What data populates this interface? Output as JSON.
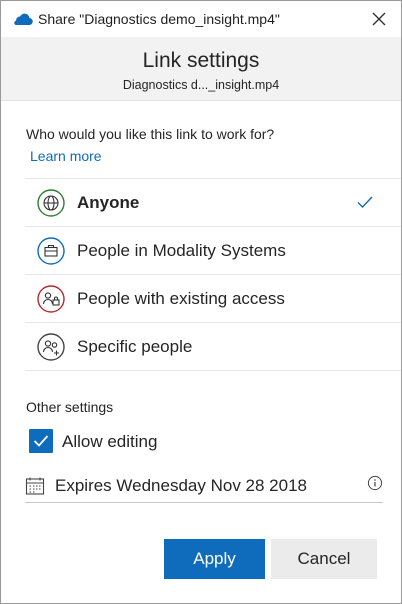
{
  "window": {
    "title": "Share \"Diagnostics demo_insight.mp4\"",
    "app_icon": "onedrive-cloud-icon",
    "close_icon": "close-icon"
  },
  "header": {
    "title": "Link settings",
    "filename": "Diagnostics d..._insight.mp4"
  },
  "audience": {
    "question": "Who would you like this link to work for?",
    "learn_more": "Learn more",
    "options": [
      {
        "label": "Anyone",
        "icon": "globe-icon",
        "selected": true,
        "accent": "#2e7d32"
      },
      {
        "label": "People in Modality Systems",
        "icon": "briefcase-icon",
        "selected": false,
        "accent": "#0f6cbd"
      },
      {
        "label": "People with existing access",
        "icon": "people-lock-icon",
        "selected": false,
        "accent": "#b4282e"
      },
      {
        "label": "Specific people",
        "icon": "people-add-icon",
        "selected": false,
        "accent": "#444444"
      }
    ]
  },
  "other": {
    "heading": "Other settings",
    "allow_editing": {
      "label": "Allow editing",
      "checked": true
    },
    "expiry": {
      "label": "Expires Wednesday Nov 28 2018",
      "icon": "calendar-icon",
      "info_icon": "info-icon"
    }
  },
  "buttons": {
    "apply": "Apply",
    "cancel": "Cancel"
  },
  "colors": {
    "accent": "#0f6cbd",
    "header_bg": "#f2f2f2"
  }
}
